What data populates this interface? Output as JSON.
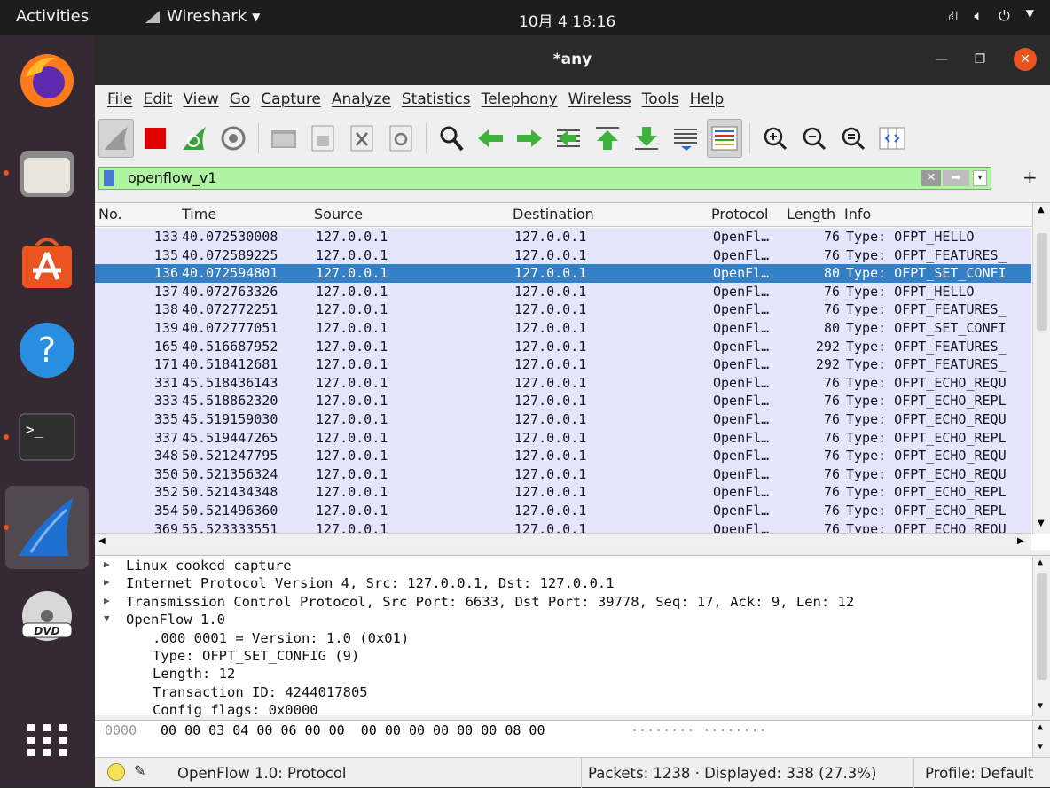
{
  "topbar": {
    "activities": "Activities",
    "app_name": "Wireshark",
    "clock": "10月 4  18:16"
  },
  "window": {
    "title": "*any"
  },
  "menu": [
    "File",
    "Edit",
    "View",
    "Go",
    "Capture",
    "Analyze",
    "Statistics",
    "Telephony",
    "Wireless",
    "Tools",
    "Help"
  ],
  "filter": {
    "value": "openflow_v1"
  },
  "columns": {
    "no": "No.",
    "time": "Time",
    "source": "Source",
    "destination": "Destination",
    "protocol": "Protocol",
    "length": "Length",
    "info": "Info"
  },
  "packets": [
    {
      "no": "133",
      "time": "40.072530008",
      "src": "127.0.0.1",
      "dst": "127.0.0.1",
      "proto": "OpenFl…",
      "len": "76",
      "info": "Type: OFPT_HELLO"
    },
    {
      "no": "135",
      "time": "40.072589225",
      "src": "127.0.0.1",
      "dst": "127.0.0.1",
      "proto": "OpenFl…",
      "len": "76",
      "info": "Type: OFPT_FEATURES_"
    },
    {
      "no": "136",
      "time": "40.072594801",
      "src": "127.0.0.1",
      "dst": "127.0.0.1",
      "proto": "OpenFl…",
      "len": "80",
      "info": "Type: OFPT_SET_CONFI"
    },
    {
      "no": "137",
      "time": "40.072763326",
      "src": "127.0.0.1",
      "dst": "127.0.0.1",
      "proto": "OpenFl…",
      "len": "76",
      "info": "Type: OFPT_HELLO"
    },
    {
      "no": "138",
      "time": "40.072772251",
      "src": "127.0.0.1",
      "dst": "127.0.0.1",
      "proto": "OpenFl…",
      "len": "76",
      "info": "Type: OFPT_FEATURES_"
    },
    {
      "no": "139",
      "time": "40.072777051",
      "src": "127.0.0.1",
      "dst": "127.0.0.1",
      "proto": "OpenFl…",
      "len": "80",
      "info": "Type: OFPT_SET_CONFI"
    },
    {
      "no": "165",
      "time": "40.516687952",
      "src": "127.0.0.1",
      "dst": "127.0.0.1",
      "proto": "OpenFl…",
      "len": "292",
      "info": "Type: OFPT_FEATURES_"
    },
    {
      "no": "171",
      "time": "40.518412681",
      "src": "127.0.0.1",
      "dst": "127.0.0.1",
      "proto": "OpenFl…",
      "len": "292",
      "info": "Type: OFPT_FEATURES_"
    },
    {
      "no": "331",
      "time": "45.518436143",
      "src": "127.0.0.1",
      "dst": "127.0.0.1",
      "proto": "OpenFl…",
      "len": "76",
      "info": "Type: OFPT_ECHO_REQU"
    },
    {
      "no": "333",
      "time": "45.518862320",
      "src": "127.0.0.1",
      "dst": "127.0.0.1",
      "proto": "OpenFl…",
      "len": "76",
      "info": "Type: OFPT_ECHO_REPL"
    },
    {
      "no": "335",
      "time": "45.519159030",
      "src": "127.0.0.1",
      "dst": "127.0.0.1",
      "proto": "OpenFl…",
      "len": "76",
      "info": "Type: OFPT_ECHO_REQU"
    },
    {
      "no": "337",
      "time": "45.519447265",
      "src": "127.0.0.1",
      "dst": "127.0.0.1",
      "proto": "OpenFl…",
      "len": "76",
      "info": "Type: OFPT_ECHO_REPL"
    },
    {
      "no": "348",
      "time": "50.521247795",
      "src": "127.0.0.1",
      "dst": "127.0.0.1",
      "proto": "OpenFl…",
      "len": "76",
      "info": "Type: OFPT_ECHO_REQU"
    },
    {
      "no": "350",
      "time": "50.521356324",
      "src": "127.0.0.1",
      "dst": "127.0.0.1",
      "proto": "OpenFl…",
      "len": "76",
      "info": "Type: OFPT_ECHO_REQU"
    },
    {
      "no": "352",
      "time": "50.521434348",
      "src": "127.0.0.1",
      "dst": "127.0.0.1",
      "proto": "OpenFl…",
      "len": "76",
      "info": "Type: OFPT_ECHO_REPL"
    },
    {
      "no": "354",
      "time": "50.521496360",
      "src": "127.0.0.1",
      "dst": "127.0.0.1",
      "proto": "OpenFl…",
      "len": "76",
      "info": "Type: OFPT_ECHO_REPL"
    },
    {
      "no": "369",
      "time": "55.523333551",
      "src": "127.0.0.1",
      "dst": "127.0.0.1",
      "proto": "OpenFl…",
      "len": "76",
      "info": "Type: OFPT_ECHO_REQU"
    }
  ],
  "selected_packet": "136",
  "details": [
    {
      "indent": 0,
      "expander": "closed",
      "text": "Linux cooked capture"
    },
    {
      "indent": 0,
      "expander": "closed",
      "text": "Internet Protocol Version 4, Src: 127.0.0.1, Dst: 127.0.0.1"
    },
    {
      "indent": 0,
      "expander": "closed",
      "text": "Transmission Control Protocol, Src Port: 6633, Dst Port: 39778, Seq: 17, Ack: 9, Len: 12"
    },
    {
      "indent": 0,
      "expander": "open",
      "text": "OpenFlow 1.0"
    },
    {
      "indent": 1,
      "expander": "none",
      "text": ".000 0001 = Version: 1.0 (0x01)"
    },
    {
      "indent": 1,
      "expander": "none",
      "text": "Type: OFPT_SET_CONFIG (9)"
    },
    {
      "indent": 1,
      "expander": "none",
      "text": "Length: 12"
    },
    {
      "indent": 1,
      "expander": "none",
      "text": "Transaction ID: 4244017805"
    },
    {
      "indent": 1,
      "expander": "none",
      "text": "Config flags: 0x0000"
    }
  ],
  "hex": {
    "offset": "0000",
    "bytes": "00 00 03 04 00 06 00 00  00 00 00 00 00 00 08 00",
    "ascii": "········ ········"
  },
  "status": {
    "expert_info": "OpenFlow 1.0: Protocol",
    "packets": "Packets: 1238 · Displayed: 338 (27.3%)",
    "profile": "Profile: Default"
  },
  "colors": {
    "row_bg": "#e6e5fd",
    "selected_bg": "#3380c7",
    "filter_ok": "#aff3a3",
    "ubuntu_orange": "#e95420"
  }
}
